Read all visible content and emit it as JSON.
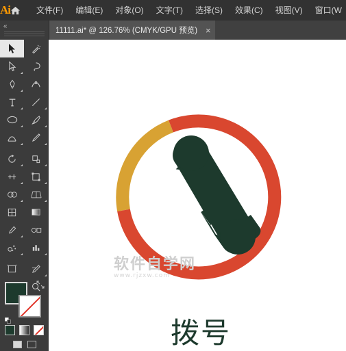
{
  "app": {
    "name": "Ai",
    "logo_label": "Ai",
    "home_icon": "home-icon"
  },
  "menubar": {
    "items": [
      {
        "label": "文件(F)"
      },
      {
        "label": "编辑(E)"
      },
      {
        "label": "对象(O)"
      },
      {
        "label": "文字(T)"
      },
      {
        "label": "选择(S)"
      },
      {
        "label": "效果(C)"
      },
      {
        "label": "视图(V)"
      },
      {
        "label": "窗口(W"
      }
    ]
  },
  "tabbar": {
    "tabs": [
      {
        "label": "11111.ai* @ 126.76% (CMYK/GPU 预览)",
        "close_glyph": "×"
      }
    ]
  },
  "toolbar": {
    "collapse_glyph": "«",
    "tools": [
      {
        "name": "selection-tool",
        "selected": true
      },
      {
        "name": "magic-wand-tool",
        "selected": false
      },
      {
        "name": "direct-selection-tool",
        "selected": false
      },
      {
        "name": "lasso-tool",
        "selected": false
      },
      {
        "name": "pen-tool",
        "selected": false
      },
      {
        "name": "curvature-tool",
        "selected": false
      },
      {
        "name": "type-tool",
        "selected": false
      },
      {
        "name": "line-segment-tool",
        "selected": false
      },
      {
        "name": "ellipse-tool",
        "selected": false
      },
      {
        "name": "paintbrush-tool",
        "selected": false
      },
      {
        "name": "shaper-tool",
        "selected": false
      },
      {
        "name": "pencil-tool",
        "selected": false
      },
      {
        "name": "rotate-tool",
        "selected": false
      },
      {
        "name": "scale-tool",
        "selected": false
      },
      {
        "name": "width-tool",
        "selected": false
      },
      {
        "name": "free-transform-tool",
        "selected": false
      },
      {
        "name": "shape-builder-tool",
        "selected": false
      },
      {
        "name": "perspective-grid-tool",
        "selected": false
      },
      {
        "name": "mesh-tool",
        "selected": false
      },
      {
        "name": "gradient-tool",
        "selected": false
      },
      {
        "name": "eyedropper-tool",
        "selected": false
      },
      {
        "name": "blend-tool",
        "selected": false
      },
      {
        "name": "symbol-sprayer-tool",
        "selected": false
      },
      {
        "name": "column-graph-tool",
        "selected": false
      },
      {
        "name": "artboard-tool",
        "selected": false
      },
      {
        "name": "slice-tool",
        "selected": false
      },
      {
        "name": "hand-tool",
        "selected": false
      },
      {
        "name": "zoom-tool",
        "selected": false
      }
    ],
    "fill_color": "#1d3a2d",
    "stroke_color": "#ffffff",
    "stroke_none": true,
    "color_modes": [
      "solid-color",
      "gradient",
      "none"
    ],
    "screen_modes": [
      "normal-screen-mode",
      "full-screen-mode"
    ]
  },
  "canvas": {
    "watermark": {
      "text": "软件自学网",
      "subtext": "www.rjzxw.com"
    },
    "artwork": {
      "name": "phone-dial-icon",
      "ring_colors": [
        "#d8a233",
        "#d9472f"
      ],
      "handset_color": "#1d3a2d",
      "label": "拨号"
    }
  }
}
